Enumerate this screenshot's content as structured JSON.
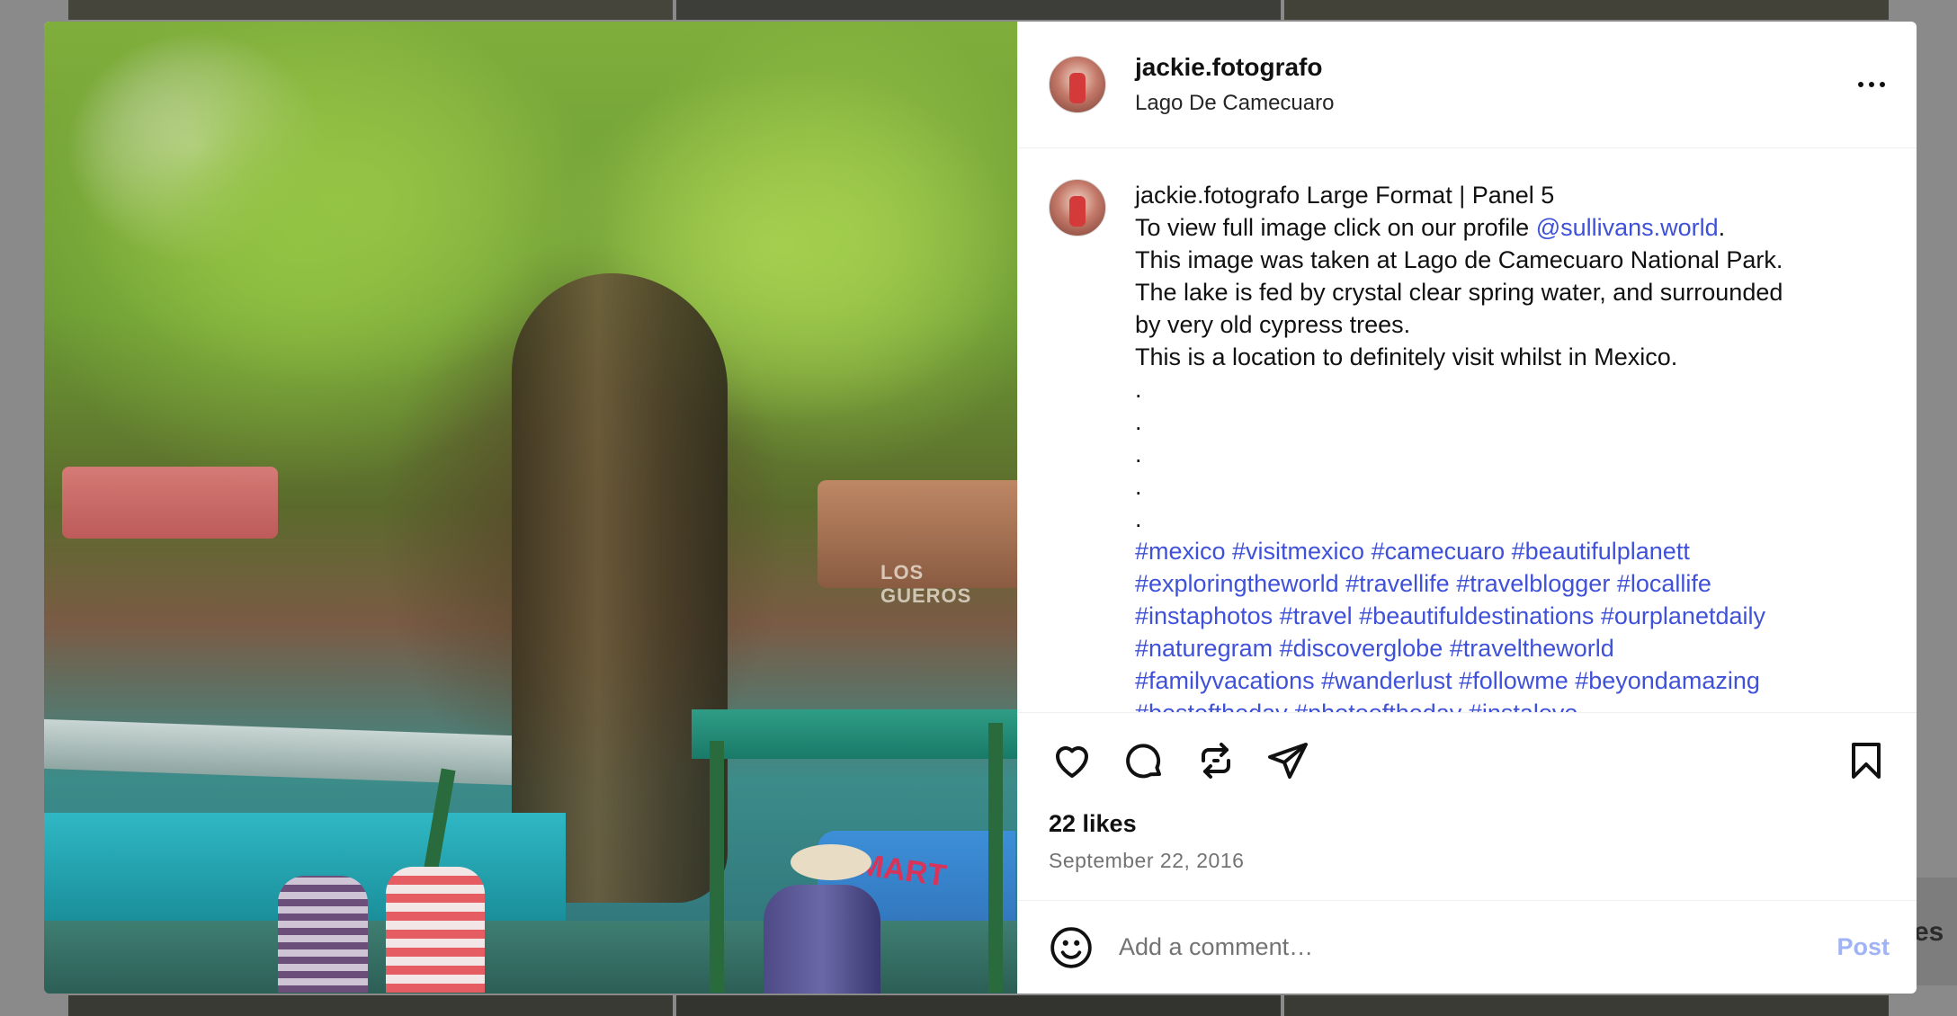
{
  "background": {
    "peek_text": "es"
  },
  "post": {
    "header": {
      "username": "jackie.fotografo",
      "location": "Lago De Camecuaro"
    },
    "photo": {
      "sign_text": "LOS GUEROS",
      "boat_text": "MART"
    },
    "caption": {
      "username": "jackie.fotografo",
      "title": "Large Format | Panel 5",
      "line2_prefix": "To view full image click on our profile ",
      "mention": "@sullivans.world",
      "line2_suffix": ".",
      "line3": "This image was taken at Lago de Camecuaro National Park.",
      "line4": "The lake is fed by crystal clear spring water, and surrounded",
      "line5": "by very old cypress trees.",
      "line6": "This is a location to definitely visit whilst in Mexico.",
      "dots": [
        ".",
        ".",
        ".",
        ".",
        "."
      ],
      "hashtags": [
        "#mexico #visitmexico #camecuaro #beautifulplanett",
        "#exploringtheworld #travellife #travelblogger #locallife",
        "#instaphotos #travel #beautifuldestinations #ourplanetdaily",
        "#naturegram #discoverglobe #traveltheworld",
        "#familyvacations #wanderlust #followme #beyondamazing",
        "#bestoftheday #photooftheday #instalove"
      ]
    },
    "likes": "22 likes",
    "date": "September 22, 2016",
    "comment": {
      "placeholder": "Add a comment…",
      "post_label": "Post"
    },
    "icons": {
      "like": "heart-icon",
      "comment": "comment-icon",
      "repost": "repost-icon",
      "share": "share-icon",
      "save": "bookmark-icon",
      "emoji": "emoji-icon",
      "more": "more-options-icon"
    },
    "colors": {
      "link": "#3f51d8",
      "post_button": "#9fb3f5",
      "muted": "#737373"
    }
  }
}
